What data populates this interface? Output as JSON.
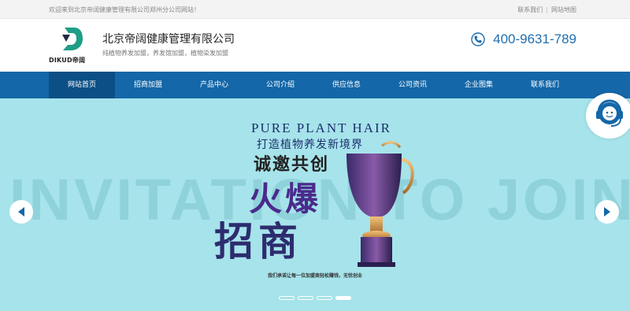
{
  "topbar": {
    "welcome": "欢迎来到北京帝阔健康管理有限公司郑州分公司网站！",
    "contact_link": "联系我们",
    "sitemap_link": "网站地图",
    "separator": "|"
  },
  "header": {
    "logo_text": "DIKUD帝阔",
    "company_name": "北京帝阔健康管理有限公司",
    "subtitle": "纯植物养发加盟，养发馆加盟，植物染发加盟",
    "phone": "400-9631-789"
  },
  "nav": {
    "items": [
      {
        "label": "网站首页",
        "active": true
      },
      {
        "label": "招商加盟",
        "active": false
      },
      {
        "label": "产品中心",
        "active": false
      },
      {
        "label": "公司介绍",
        "active": false
      },
      {
        "label": "供应信息",
        "active": false
      },
      {
        "label": "公司资讯",
        "active": false
      },
      {
        "label": "企业图集",
        "active": false
      },
      {
        "label": "联系我们",
        "active": false
      }
    ]
  },
  "banner": {
    "watermark": "INVITATION TO JOIN",
    "headline_en": "PURE PLANT HAIR",
    "slogan": "打造植物养发新境界",
    "invite": "诚邀共创",
    "hot": "火爆",
    "recruit": "招商",
    "promise": "我们承诺让每一位加盟商轻松赚钱，无忧创业",
    "slide_count": 4,
    "active_slide": 4
  },
  "colors": {
    "nav_bg": "#1467a8",
    "nav_active": "#0b4f86",
    "banner_bg": "#a6e3ea",
    "phone": "#1f6fb0",
    "logo_green": "#1e9e86"
  },
  "icons": {
    "phone": "phone-icon",
    "prev": "chevron-left-icon",
    "next": "chevron-right-icon",
    "support": "customer-service-icon"
  }
}
